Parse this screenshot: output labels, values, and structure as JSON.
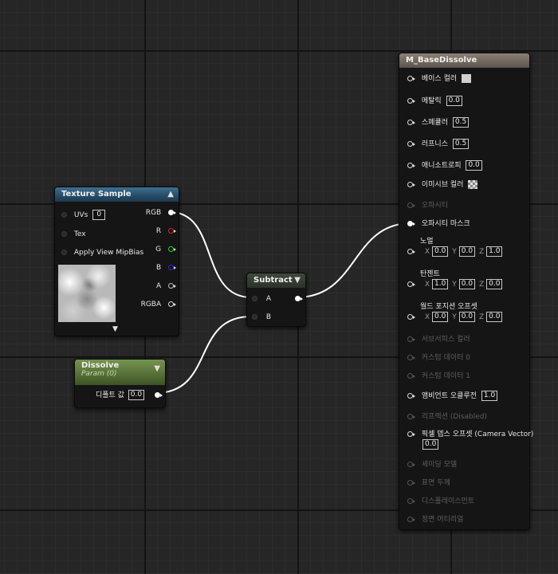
{
  "texture_sample": {
    "title": "Texture Sample",
    "inputs": [
      {
        "label": "UVs",
        "value": "0"
      },
      {
        "label": "Tex"
      },
      {
        "label": "Apply View MipBias"
      }
    ],
    "outputs": [
      "RGB",
      "R",
      "G",
      "B",
      "A",
      "RGBA"
    ]
  },
  "subtract": {
    "title": "Subtract",
    "inputs": [
      "A",
      "B"
    ]
  },
  "dissolve": {
    "title": "Dissolve",
    "subtitle": "Param (0)",
    "default_label": "디폴트 값",
    "default_value": "0.0"
  },
  "material": {
    "title": "M_BaseDissolve",
    "pins": [
      {
        "label": "베이스 컬러"
      },
      {
        "label": "메탈릭",
        "value": "0.0"
      },
      {
        "label": "스페큘러",
        "value": "0.5"
      },
      {
        "label": "러프니스",
        "value": "0.5"
      },
      {
        "label": "애니소트로피",
        "value": "0.0"
      },
      {
        "label": "이미시브 컬러"
      },
      {
        "label": "오파시티"
      },
      {
        "label": "오파시티 마스크"
      },
      {
        "label": "노멀",
        "x": "0.0",
        "y": "0.0",
        "z": "1.0"
      },
      {
        "label": "탄젠트",
        "x": "1.0",
        "y": "0.0",
        "z": "0.0"
      },
      {
        "label": "월드 포지션 오프셋",
        "x": "0.0",
        "y": "0.0",
        "z": "0.0"
      },
      {
        "label": "서브서피스 컬러"
      },
      {
        "label": "커스텀 데이터 0"
      },
      {
        "label": "커스텀 데이터 1"
      },
      {
        "label": "앰비언트 오클루전",
        "value": "1.0"
      },
      {
        "label": "리프랙션 (Disabled)"
      },
      {
        "label": "픽셀 뎁스 오프셋 (Camera Vector)",
        "value": "0.0"
      },
      {
        "label": "셰이딩 모델"
      },
      {
        "label": "표면 두께"
      },
      {
        "label": "디스플레이스먼트"
      },
      {
        "label": "정면 머티리얼"
      }
    ],
    "axis_labels": {
      "x": "X",
      "y": "Y",
      "z": "Z"
    }
  },
  "colors": {
    "wire": "#ffffff",
    "pin_r": "#e02020",
    "pin_g": "#20d020",
    "pin_b": "#2020e0",
    "base_color_swatch": "#d0d0d0"
  },
  "icons": {
    "collapse_up": "chevron-up-icon",
    "collapse_down": "chevron-down-icon",
    "expand": "chevron-down-icon"
  }
}
